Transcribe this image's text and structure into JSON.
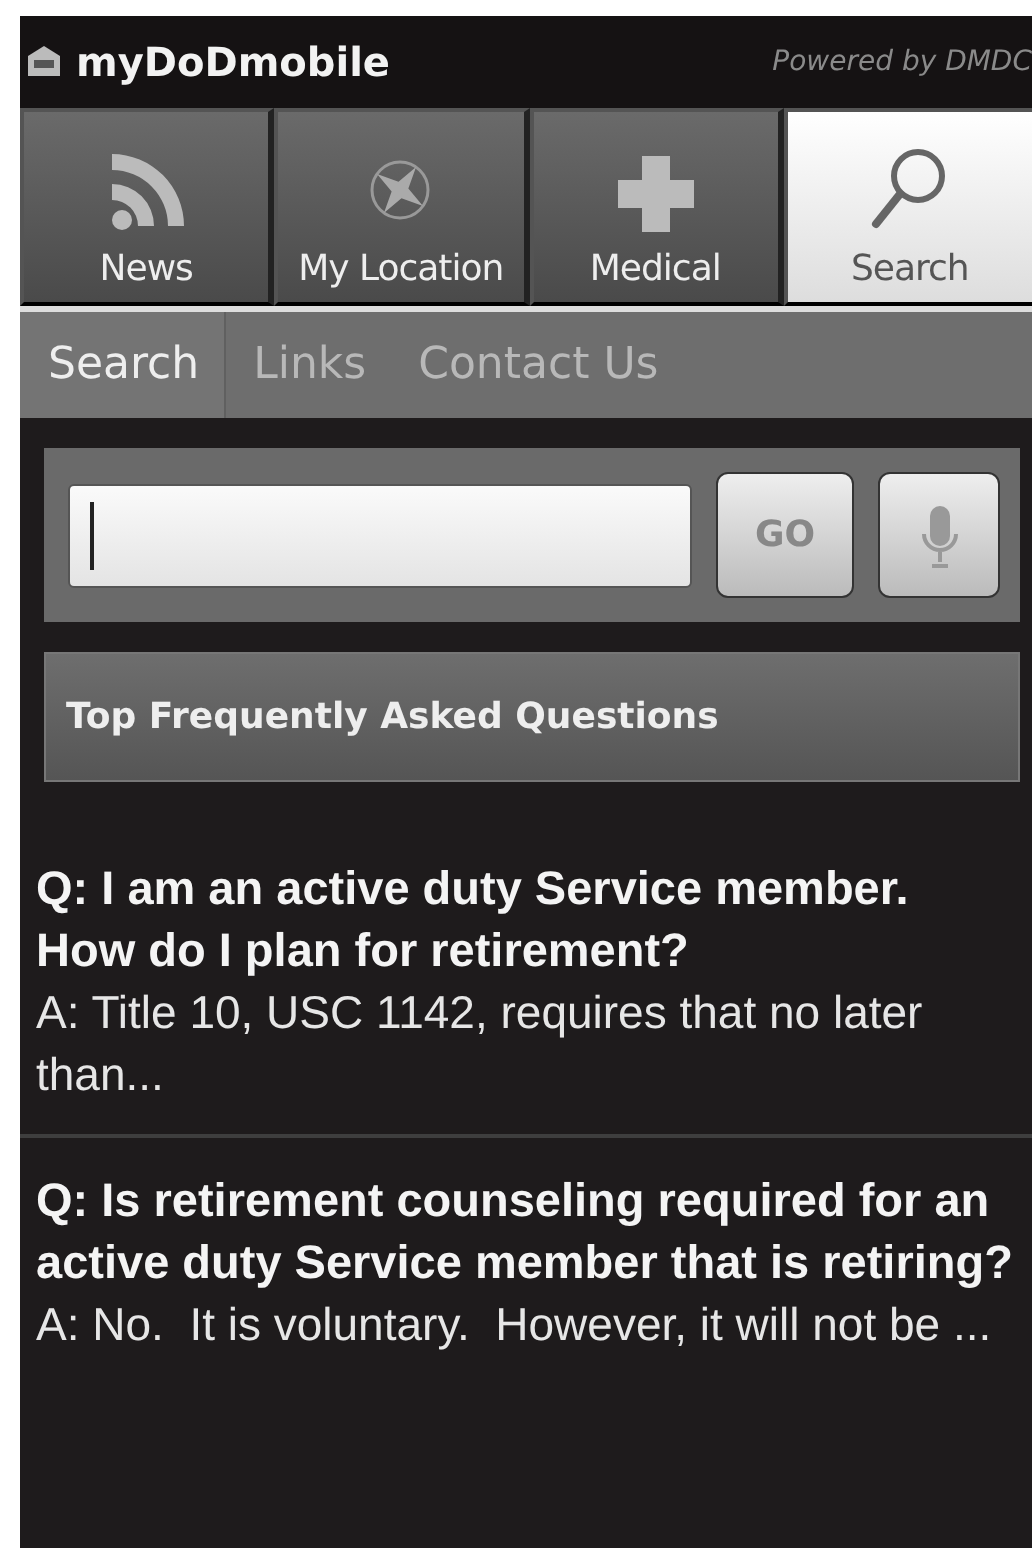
{
  "app_bar": {
    "title": "myDoDmobile",
    "powered_by": "Powered by DMDC"
  },
  "tabs": [
    {
      "label": "News",
      "kind": "rss",
      "selected": false
    },
    {
      "label": "My Location",
      "kind": "compass",
      "selected": false
    },
    {
      "label": "Medical",
      "kind": "cross",
      "selected": false
    },
    {
      "label": "Search",
      "kind": "magnifier",
      "selected": true
    }
  ],
  "subtabs": [
    {
      "label": "Search",
      "selected": true
    },
    {
      "label": "Links",
      "selected": false
    },
    {
      "label": "Contact Us",
      "selected": false
    }
  ],
  "search": {
    "go_label": "GO"
  },
  "faq": {
    "heading": "Top Frequently Asked Questions",
    "items": [
      {
        "question": "Q: I am an active duty Service member. How do I plan for retirement?",
        "answer": "A: Title 10, USC 1142, requires that no later than..."
      },
      {
        "question": "Q: Is retirement counseling required for an active duty Service member that is retiring?",
        "answer": "A: No.  It is voluntary.  However, it will not be ..."
      }
    ]
  }
}
